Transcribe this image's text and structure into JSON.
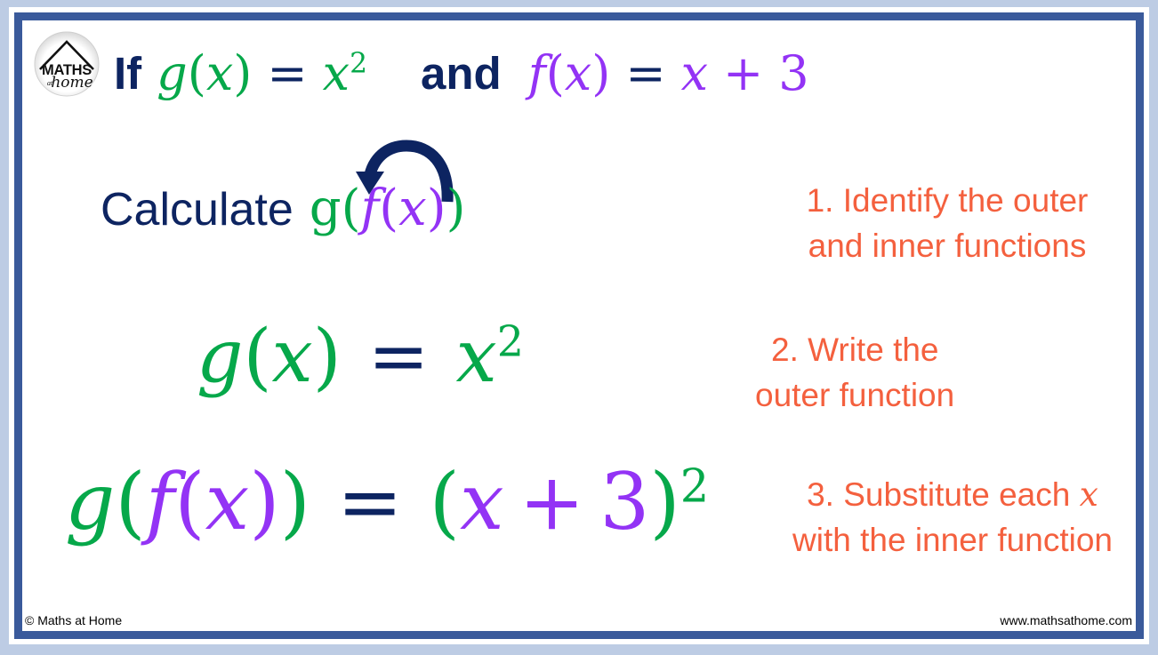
{
  "colors": {
    "page_background": "#bdcce4",
    "frame_border": "#3a5a9b",
    "canvas": "#ffffff",
    "navy_text": "#0d2461",
    "green_function": "#06a84a",
    "purple_function": "#9333f5",
    "orange_note": "#f4603e"
  },
  "logo": {
    "brand_top": "MATHS",
    "brand_mid": "at",
    "brand_bottom": "home",
    "shape": "house-roof-in-circle"
  },
  "header": {
    "if_word": "If",
    "and_word": "and",
    "equals": "=",
    "g_name": "g",
    "g_open": "(",
    "g_var": "x",
    "g_close": ")",
    "g_rhs_var": "x",
    "g_rhs_exp": "2",
    "f_name": "f",
    "f_open": "(",
    "f_var": "x",
    "f_close": ")",
    "f_rhs_var": "x",
    "f_rhs_plus": "+",
    "f_rhs_const": "3"
  },
  "calculate": {
    "label": "Calculate",
    "outer_name": "g",
    "outer_open": "(",
    "inner_name": "f",
    "inner_open": "(",
    "inner_var": "x",
    "inner_close": ")",
    "outer_close": ")",
    "arrow": "curved-substitution-arrow"
  },
  "equation_2": {
    "lhs_name": "g",
    "lhs_open": "(",
    "lhs_var": "x",
    "lhs_close": ")",
    "equals": "=",
    "rhs_var": "x",
    "rhs_exp": "2"
  },
  "equation_3": {
    "lhs_outer_name": "g",
    "lhs_outer_open": "(",
    "lhs_inner_name": "f",
    "lhs_inner_open": "(",
    "lhs_inner_var": "x",
    "lhs_inner_close": ")",
    "lhs_outer_close": ")",
    "equals": "=",
    "rhs_open": "(",
    "rhs_var": "x",
    "rhs_plus": "+",
    "rhs_const": "3",
    "rhs_close": ")",
    "rhs_exp": "2"
  },
  "notes": {
    "note1_line1": "1. Identify the outer",
    "note1_line2": "and inner functions",
    "note2_line1": "2. Write the",
    "note2_line2": "outer function",
    "note3_line1_a": "3. Substitute each",
    "note3_line1_var": "x",
    "note3_line2": "with the inner function"
  },
  "footer": {
    "copyright": "© Maths at Home",
    "website": "www.mathsathome.com"
  }
}
